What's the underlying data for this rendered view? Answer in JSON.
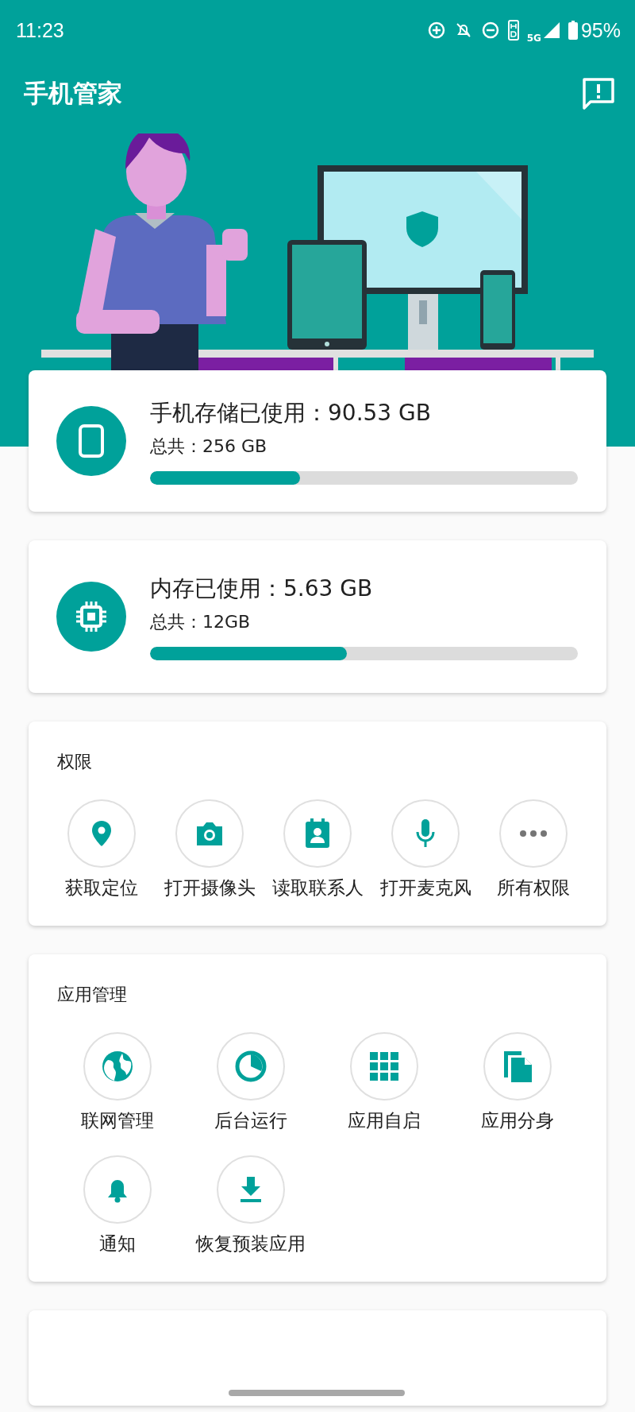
{
  "status_bar": {
    "time": "11:23",
    "network": "5G",
    "battery": "95%"
  },
  "header": {
    "title": "手机管家"
  },
  "storage_cards": [
    {
      "title": "手机存储已使用：90.53 GB",
      "total": "总共：256 GB",
      "level": 0.35
    },
    {
      "title": "内存已使用：5.63 GB",
      "total": "总共：12GB",
      "level": 0.46
    }
  ],
  "sections": [
    {
      "title": "权限",
      "items": [
        {
          "label": "获取定位"
        },
        {
          "label": "打开摄像头"
        },
        {
          "label": "读取联系人"
        },
        {
          "label": "打开麦克风"
        },
        {
          "label": "所有权限"
        }
      ]
    },
    {
      "title": "应用管理",
      "items": [
        {
          "label": "联网管理"
        },
        {
          "label": "后台运行"
        },
        {
          "label": "应用自启"
        },
        {
          "label": "应用分身"
        },
        {
          "label": "通知"
        },
        {
          "label": "恢复预装应用"
        }
      ]
    }
  ]
}
